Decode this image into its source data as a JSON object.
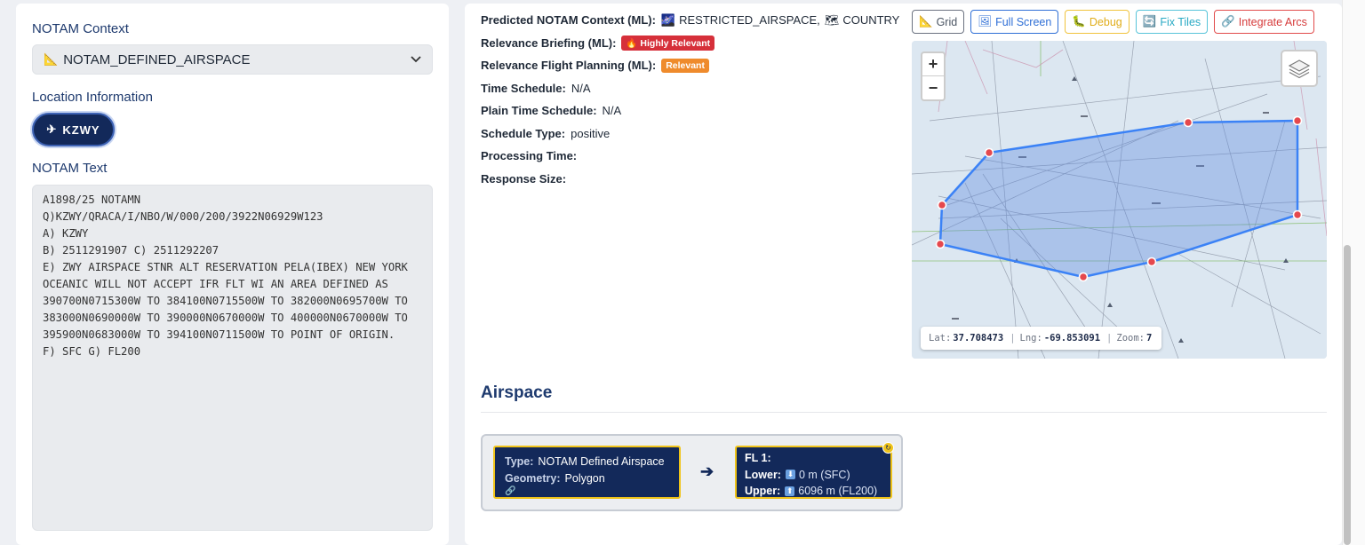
{
  "left": {
    "context_title": "NOTAM Context",
    "context_select": {
      "icon": "📐",
      "value": "NOTAM_DEFINED_AIRSPACE"
    },
    "location_title": "Location Information",
    "location_pill": {
      "icon": "✈",
      "value": "KZWY"
    },
    "notam_title": "NOTAM Text",
    "notam_text": "A1898/25 NOTAMN\nQ)KZWY/QRACA/I/NBO/W/000/200/3922N06929W123\nA) KZWY\nB) 2511291907 C) 2511292207\nE) ZWY AIRSPACE STNR ALT RESERVATION PELA(IBEX) NEW YORK\nOCEANIC WILL NOT ACCEPT IFR FLT WI AN AREA DEFINED AS\n390700N0715300W TO 384100N0715500W TO 382000N0695700W TO\n383000N0690000W TO 390000N0670000W TO 400000N0670000W TO\n395900N0683000W TO 394100N0711500W TO POINT OF ORIGIN.\nF) SFC G) FL200"
  },
  "info": {
    "predicted_label": "Predicted NOTAM Context (ML):",
    "predicted_icon1": "🌌",
    "predicted_value1": "RESTRICTED_AIRSPACE,",
    "predicted_icon2": "🗺",
    "predicted_value2": "COUNTRY",
    "briefing_label": "Relevance Briefing (ML):",
    "briefing_badge": "🔥 Highly Relevant",
    "planning_label": "Relevance Flight Planning (ML):",
    "planning_badge": "Relevant",
    "time_schedule_label": "Time Schedule:",
    "time_schedule_value": "N/A",
    "plain_time_label": "Plain Time Schedule:",
    "plain_time_value": "N/A",
    "schedule_type_label": "Schedule Type:",
    "schedule_type_value": "positive",
    "processing_label": "Processing Time:",
    "processing_value": "",
    "response_label": "Response Size:",
    "response_value": ""
  },
  "toolbar": {
    "grid": {
      "icon": "📐",
      "label": "Grid"
    },
    "fullscreen": {
      "icon": "🖼",
      "label": "Full Screen"
    },
    "debug": {
      "icon": "🐛",
      "label": "Debug"
    },
    "fixtiles": {
      "icon": "🔄",
      "label": "Fix Tiles"
    },
    "arcs": {
      "icon": "🔗",
      "label": "Integrate Arcs"
    }
  },
  "map": {
    "zoom_in": "+",
    "zoom_out": "−",
    "lat_label": "Lat:",
    "lat_value": "37.708473",
    "lng_label": "Lng:",
    "lng_value": "-69.853091",
    "zoom_label": "Zoom:",
    "zoom_value": "7",
    "polygon_color": "#3b82f6",
    "vertex_color": "#e5484d"
  },
  "airspace": {
    "title": "Airspace",
    "type_label": "Type:",
    "type_value": "NOTAM Defined Airspace",
    "geometry_label": "Geometry:",
    "geometry_value": "Polygon",
    "link_icon": "🔗",
    "arrow": "➔",
    "fl_title": "FL 1:",
    "lower_label": "Lower:",
    "lower_icon": "⬇",
    "lower_value": "0 m (SFC)",
    "upper_label": "Upper:",
    "upper_icon": "⬆",
    "upper_value": "6096 m (FL200)"
  }
}
